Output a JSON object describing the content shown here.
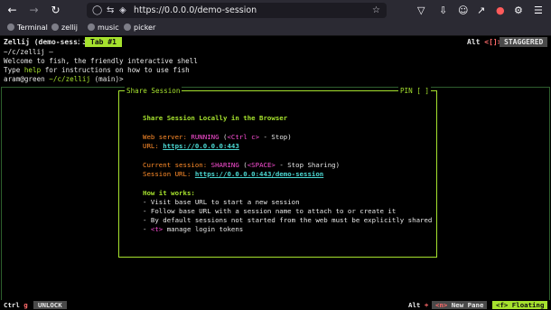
{
  "browser": {
    "back_icon": "arrow-left-icon",
    "forward_icon": "arrow-right-icon",
    "reload_icon": "reload-icon",
    "url": "https://0.0.0.0/demo-session"
  },
  "bookmarks": [
    {
      "label": "Terminal"
    },
    {
      "label": "zellij"
    },
    {
      "label": "music"
    },
    {
      "label": "picker"
    }
  ],
  "zellij": {
    "session_label": "Zellij (demo-session)",
    "tab_label": "Tab #1",
    "alt_key": "Alt",
    "alt_suffix": "<[]>",
    "layout_label": "STAGGERED"
  },
  "terminal": {
    "pane_title": "~/c/zellij —",
    "line1": "Welcome to fish, the friendly interactive shell",
    "line2_pre": "Type ",
    "line2_help": "help",
    "line2_post": " for instructions on how to use fish",
    "prompt_user": "aram@green",
    "prompt_path": "~/c/zellij",
    "prompt_branch": "(main)>"
  },
  "share": {
    "title": "Share Session",
    "pin": "PIN [ ]",
    "heading": "Share Session Locally in the Browser",
    "web_server_label": "Web server: ",
    "web_server_status": "RUNNING",
    "web_server_key_open": "(",
    "web_server_key": "<Ctrl c>",
    "web_server_key_close": " - Stop)",
    "url_label": "URL: ",
    "url_value": "https://0.0.0.0:443",
    "current_label": "Current session: ",
    "current_status": "SHARING",
    "current_key_open": "(",
    "current_key": "<SPACE>",
    "current_key_close": " - Stop Sharing)",
    "session_url_label": "Session URL: ",
    "session_url_value": "https://0.0.0.0:443/demo-session",
    "how_heading": "How it works:",
    "how_1": "- Visit base URL to start a new session",
    "how_2": "- Follow base URL with a session name to attach to or create it",
    "how_3": "- By default sessions not started from the web must be explicitly shared",
    "how_4_pre": "- ",
    "how_4_key": "<t>",
    "how_4_post": " manage login tokens"
  },
  "status": {
    "ctrl_label": "Ctrl",
    "ctrl_key": "g",
    "unlock_label": "UNLOCK",
    "alt_label": "Alt",
    "alt_key": "+",
    "new_pane_key": "<n>",
    "new_pane_label": " New Pane",
    "floating_label": "<f> Floating"
  },
  "colors": {
    "accent_green": "#a6e22e",
    "link_cyan": "#4bd6d1",
    "running_orange": "#ff8c2a",
    "key_pink": "#ff4fd8"
  }
}
